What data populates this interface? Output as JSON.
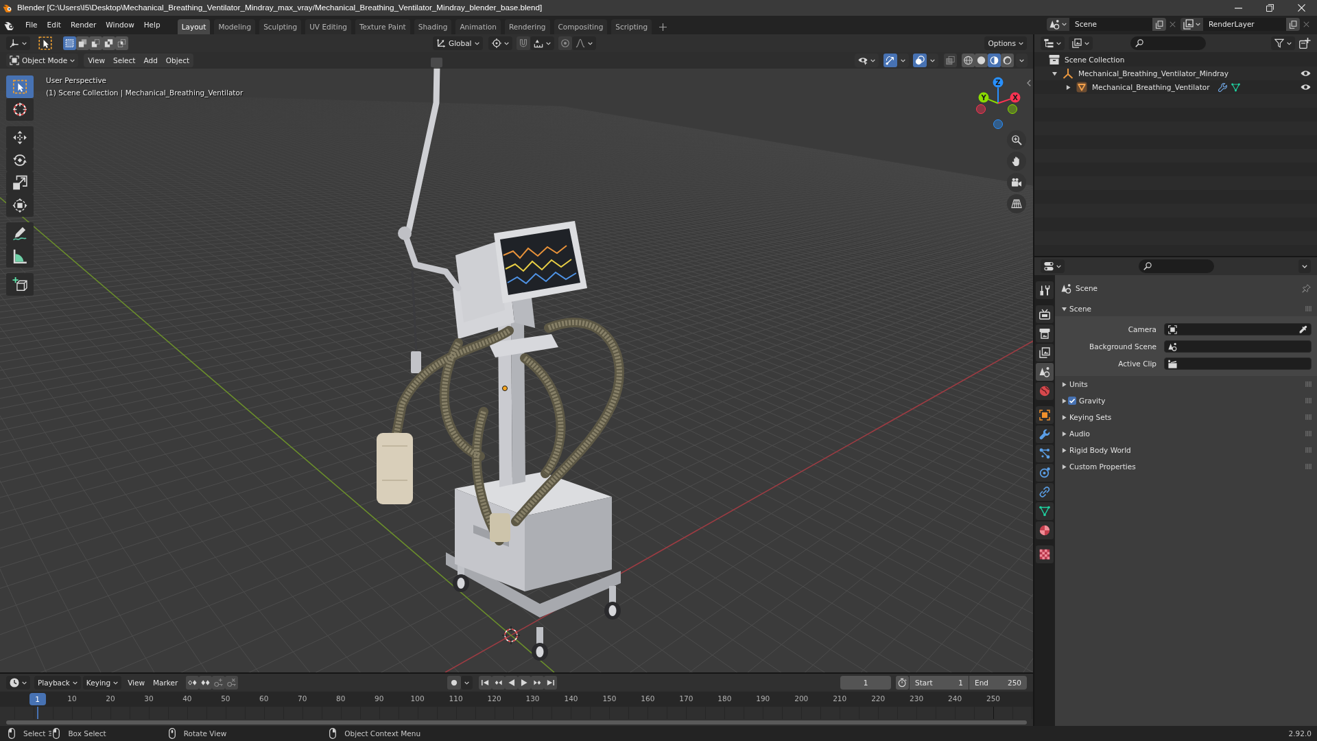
{
  "window": {
    "title": "Blender [C:\\Users\\I5\\Desktop\\Mechanical_Breathing_Ventilator_Mindray_max_vray/Mechanical_Breathing_Ventilator_Mindray_blender_base.blend]"
  },
  "menu": [
    "File",
    "Edit",
    "Render",
    "Window",
    "Help"
  ],
  "workspaces": [
    {
      "label": "Layout",
      "selected": true
    },
    {
      "label": "Modeling",
      "selected": false
    },
    {
      "label": "Sculpting",
      "selected": false
    },
    {
      "label": "UV Editing",
      "selected": false
    },
    {
      "label": "Texture Paint",
      "selected": false
    },
    {
      "label": "Shading",
      "selected": false
    },
    {
      "label": "Animation",
      "selected": false
    },
    {
      "label": "Rendering",
      "selected": false
    },
    {
      "label": "Compositing",
      "selected": false
    },
    {
      "label": "Scripting",
      "selected": false
    }
  ],
  "scene_selector": {
    "value": "Scene"
  },
  "view_layer_selector": {
    "value": "RenderLayer"
  },
  "tool_header": {
    "select_modes": [
      {
        "kind": "set",
        "selected": true
      },
      {
        "kind": "extend",
        "selected": false
      },
      {
        "kind": "subtract",
        "selected": false
      },
      {
        "kind": "difference",
        "selected": false
      },
      {
        "kind": "intersect",
        "selected": false
      }
    ],
    "orientation": "Global",
    "snap": {
      "on": false
    },
    "proportional_editing": {
      "on": false
    },
    "options": "Options"
  },
  "viewport": {
    "mode": "Object Mode",
    "menus": [
      "View",
      "Select",
      "Add",
      "Object"
    ],
    "gizmos": {
      "on": true
    },
    "overlays": {
      "on": true
    },
    "xray": {
      "on": false
    },
    "shading": [
      {
        "kind": "wireframe",
        "selected": false
      },
      {
        "kind": "solid",
        "selected": false
      },
      {
        "kind": "material",
        "selected": true
      },
      {
        "kind": "rendered",
        "selected": false
      }
    ],
    "tool_groups": [
      [
        {
          "kind": "select",
          "selected": true
        },
        {
          "kind": "cursor",
          "selected": false
        }
      ],
      [
        {
          "kind": "move",
          "selected": false
        },
        {
          "kind": "rotate",
          "selected": false
        },
        {
          "kind": "scale",
          "selected": false
        },
        {
          "kind": "transform",
          "selected": false
        }
      ],
      [
        {
          "kind": "annotate",
          "selected": false
        },
        {
          "kind": "measure",
          "selected": false
        }
      ],
      [
        {
          "kind": "add_cube",
          "selected": false
        }
      ]
    ],
    "info": [
      "User Perspective",
      "(1) Scene Collection | Mechanical_Breathing_Ventilator"
    ],
    "axes": [
      {
        "label": "Z",
        "color": "#2890ff"
      },
      {
        "label": "Y",
        "color": "#8bdc00"
      },
      {
        "label": "X",
        "color": "#ff3352"
      }
    ]
  },
  "outliner": {
    "tree": [
      {
        "label": "Scene Collection",
        "kind": "scene_collection",
        "children": [
          {
            "label": "Mechanical_Breathing_Ventilator_Mindray",
            "kind": "empty",
            "expanded": true,
            "visible": true,
            "children": [
              {
                "label": "Mechanical_Breathing_Ventilator",
                "kind": "mesh",
                "expanded": false,
                "visible": true
              }
            ]
          }
        ]
      }
    ]
  },
  "properties": {
    "tab_groups": [
      [
        {
          "kind": "tool",
          "selected": false
        }
      ],
      [
        {
          "kind": "render",
          "selected": false
        },
        {
          "kind": "output",
          "selected": false
        },
        {
          "kind": "view_layer",
          "selected": false
        },
        {
          "kind": "scene",
          "selected": true
        },
        {
          "kind": "world",
          "selected": false
        }
      ],
      [
        {
          "kind": "object",
          "selected": false
        },
        {
          "kind": "modifiers",
          "selected": false
        },
        {
          "kind": "particles",
          "selected": false
        },
        {
          "kind": "physics",
          "selected": false
        },
        {
          "kind": "constraints",
          "selected": false
        },
        {
          "kind": "data",
          "selected": false
        },
        {
          "kind": "material",
          "selected": false
        }
      ],
      [
        {
          "kind": "texture",
          "selected": false
        }
      ]
    ],
    "context": "Scene",
    "panels": [
      {
        "title": "Scene",
        "expanded": true,
        "fields": [
          {
            "kind": "camera",
            "label": "Camera"
          },
          {
            "kind": "scene",
            "label": "Background Scene"
          },
          {
            "kind": "clip",
            "label": "Active Clip"
          }
        ]
      },
      {
        "title": "Units",
        "expanded": false
      },
      {
        "title": "Gravity",
        "expanded": false,
        "checkbox": {
          "checked": true
        }
      },
      {
        "title": "Keying Sets",
        "expanded": false
      },
      {
        "title": "Audio",
        "expanded": false
      },
      {
        "title": "Rigid Body World",
        "expanded": false
      },
      {
        "title": "Custom Properties",
        "expanded": false
      }
    ]
  },
  "timeline": {
    "menus": [
      {
        "kind": "dropdown",
        "label": "Playback"
      },
      {
        "kind": "dropdown",
        "label": "Keying"
      },
      {
        "kind": "menu",
        "label": "View"
      },
      {
        "kind": "menu",
        "label": "Marker"
      }
    ],
    "auto_keying": {
      "on": false
    },
    "current_frame": "1",
    "start": {
      "label": "Start",
      "value": "1"
    },
    "end": {
      "label": "End",
      "value": "250"
    },
    "playhead": "1",
    "ruler": [
      "10",
      "20",
      "30",
      "40",
      "50",
      "60",
      "70",
      "80",
      "90",
      "100",
      "110",
      "120",
      "130",
      "140",
      "150",
      "160",
      "170",
      "180",
      "190",
      "200",
      "210",
      "220",
      "230",
      "240",
      "250"
    ]
  },
  "status_bar": {
    "hints": [
      {
        "kind": "left_click",
        "label": "Select"
      },
      {
        "kind": "left_drag",
        "label": "Box Select"
      },
      {
        "kind": "middle_click",
        "label": "Rotate View"
      },
      {
        "kind": "right_click",
        "label": "Object Context Menu"
      }
    ],
    "version": "2.92.0"
  }
}
